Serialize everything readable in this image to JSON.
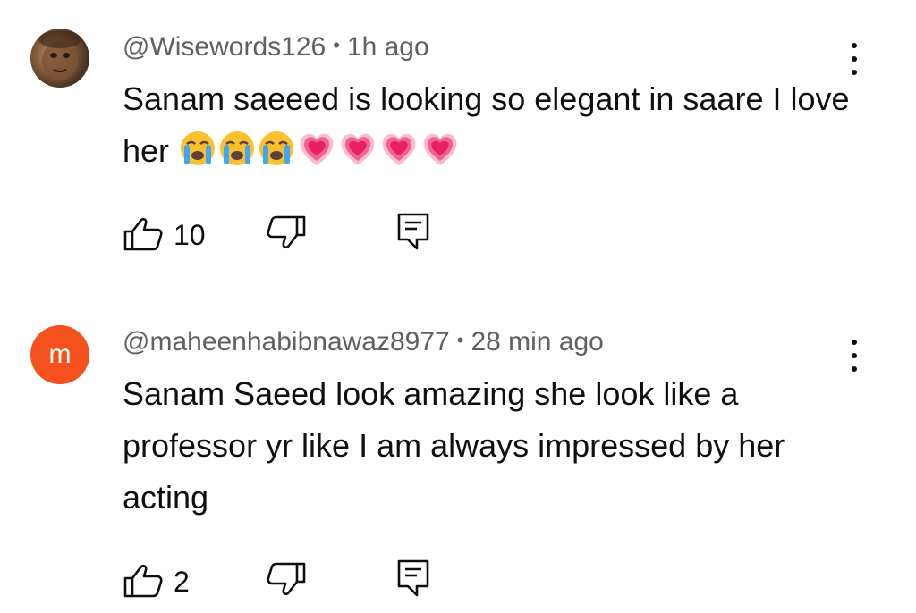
{
  "comments": [
    {
      "author": "@Wisewords126",
      "separator": "•",
      "time": "1h ago",
      "text": "Sanam saeeed is looking so elegant in saare I love her",
      "emojis": [
        "loudly-crying-face",
        "loudly-crying-face",
        "loudly-crying-face",
        "growing-heart",
        "growing-heart",
        "growing-heart",
        "growing-heart"
      ],
      "likes": "10",
      "avatar_type": "photo"
    },
    {
      "author": "@maheenhabibnawaz8977",
      "separator": "•",
      "time": "28 min ago",
      "text": "Sanam Saeed look amazing she look like a professor yr like I am always impressed by her acting",
      "likes": "2",
      "avatar_letter": "m",
      "avatar_color": "#f4511e"
    }
  ],
  "icons": {
    "like": "thumbs-up-icon",
    "dislike": "thumbs-down-icon",
    "reply": "reply-comment-icon",
    "more": "more-vert-icon"
  }
}
